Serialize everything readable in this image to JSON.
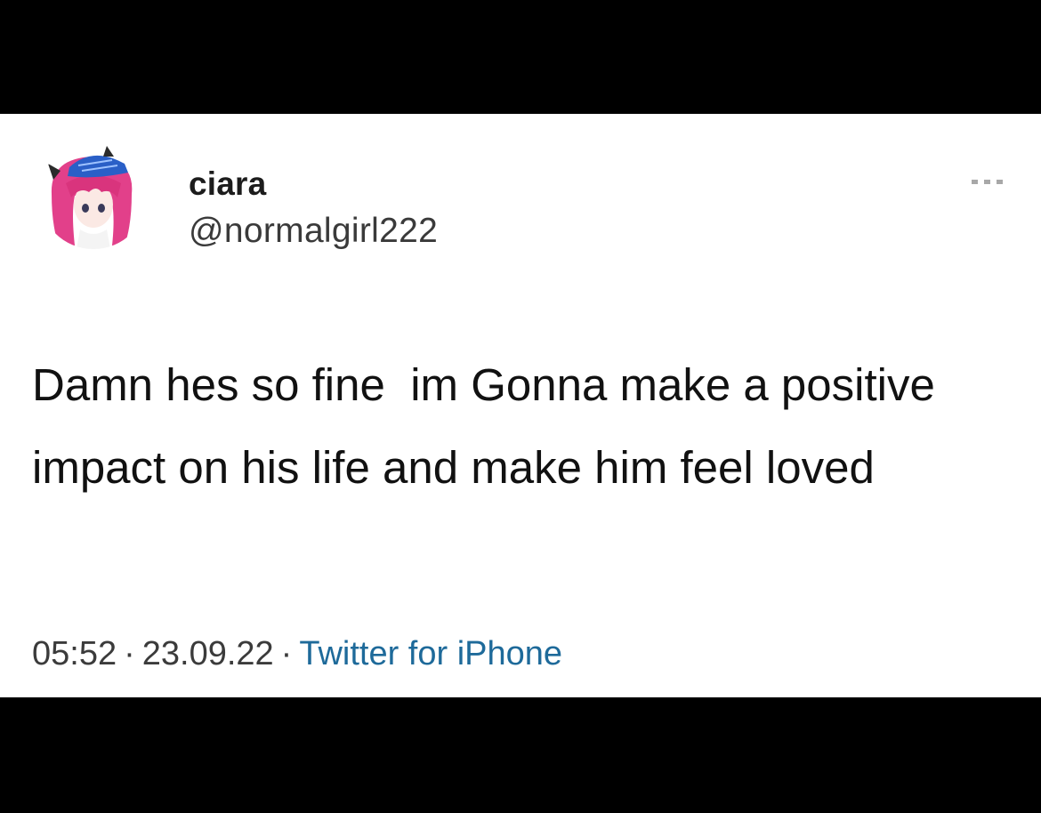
{
  "tweet": {
    "display_name": "ciara",
    "handle": "@normalgirl222",
    "text": "Damn hes so fine  im Gonna make a positive impact on his life and make him feel loved",
    "time": "05:52",
    "date": "23.09.22",
    "source": "Twitter for iPhone",
    "separator": "·"
  },
  "icons": {
    "avatar": "anime-girl-avatar",
    "more": "more-options-icon"
  },
  "colors": {
    "background": "#ffffff",
    "letterbox": "#000000",
    "source_link": "#1e6a9a"
  }
}
